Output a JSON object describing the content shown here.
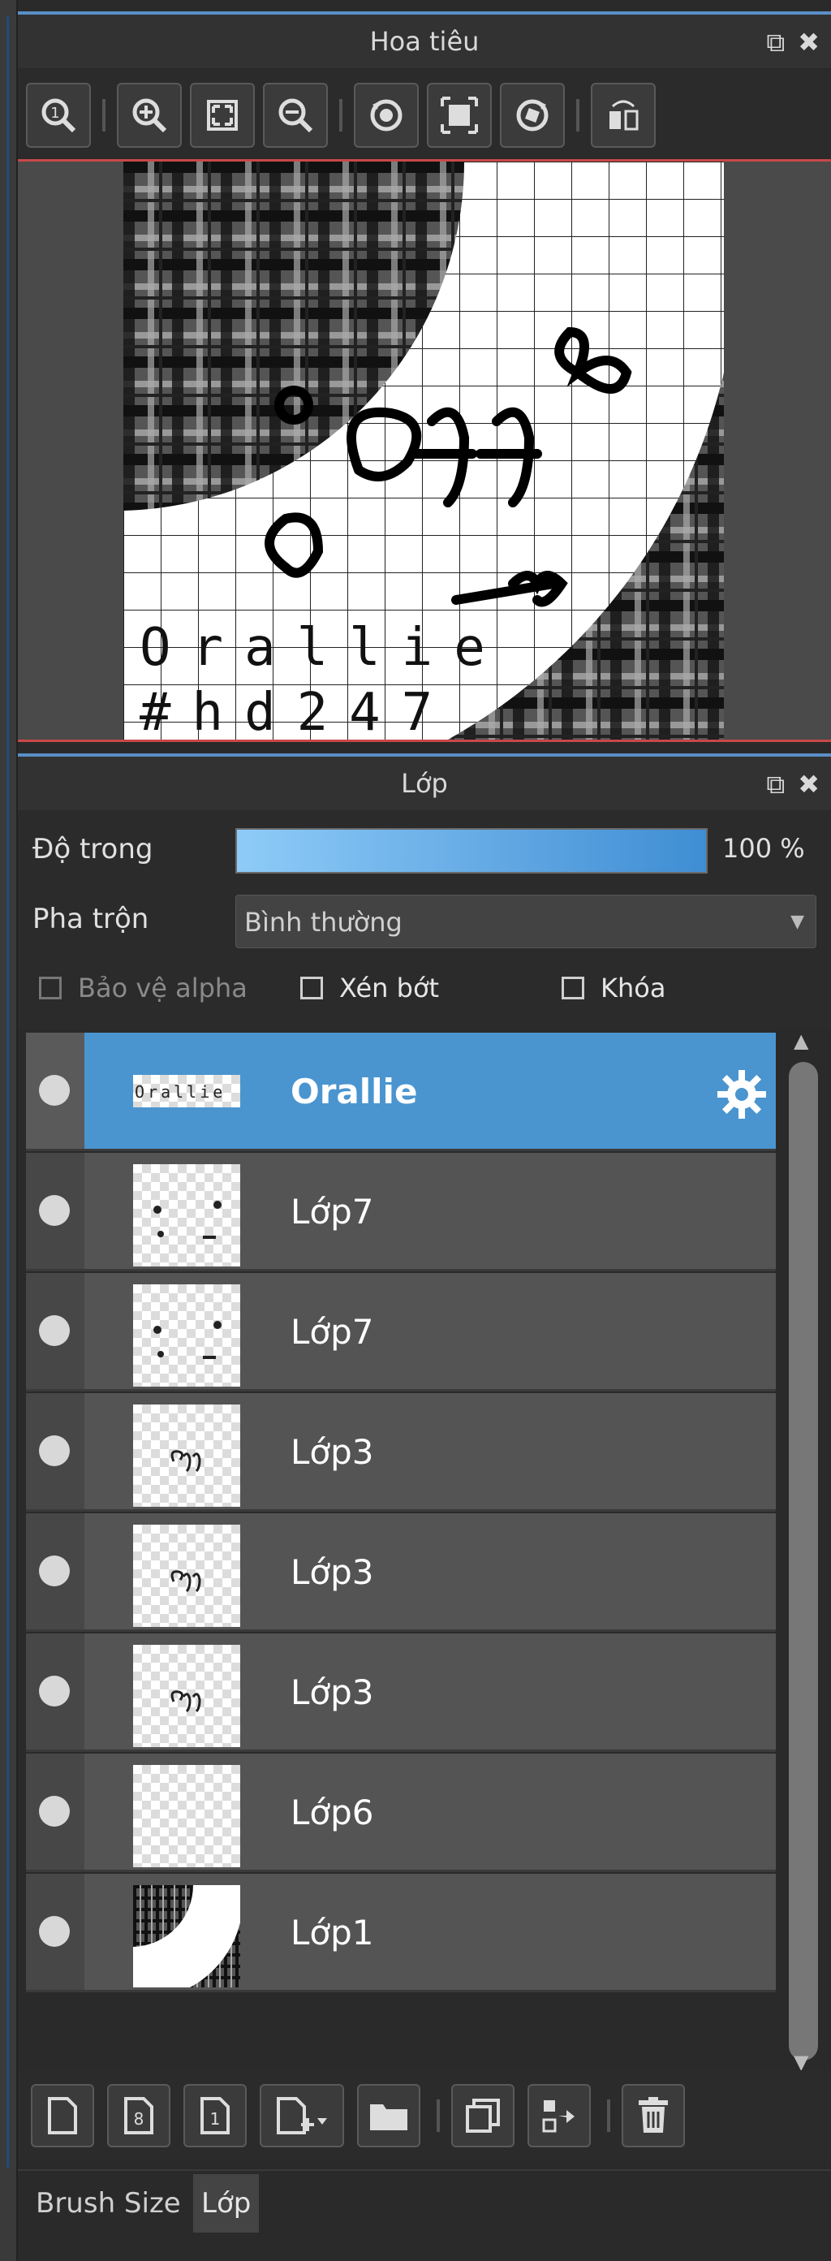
{
  "navigator": {
    "title": "Hoa tiêu",
    "canvas_text": {
      "line1": "Orallie",
      "line2": "#hd247",
      "scribble": "off"
    }
  },
  "layer_panel": {
    "title": "Lớp",
    "opacity_label": "Độ trong",
    "opacity_value": "100 %",
    "opacity_fraction": 1.0,
    "blend_label": "Pha trộn",
    "blend_value": "Bình thường",
    "checkboxes": {
      "protect_alpha": "Bảo vệ alpha",
      "clip": "Xén bớt",
      "lock": "Khóa"
    },
    "layers": [
      {
        "name": "Orallie",
        "selected": true
      },
      {
        "name": "Lớp7"
      },
      {
        "name": "Lớp7"
      },
      {
        "name": "Lớp3"
      },
      {
        "name": "Lớp3"
      },
      {
        "name": "Lớp3"
      },
      {
        "name": "Lớp6"
      },
      {
        "name": "Lớp1"
      }
    ]
  },
  "tabs": [
    {
      "label": "Brush Size"
    },
    {
      "label": "Lớp"
    }
  ],
  "colors": {
    "accent": "#4a95d0",
    "panel": "#2b2b2b",
    "row": "#545454",
    "border_red": "#c84848"
  }
}
